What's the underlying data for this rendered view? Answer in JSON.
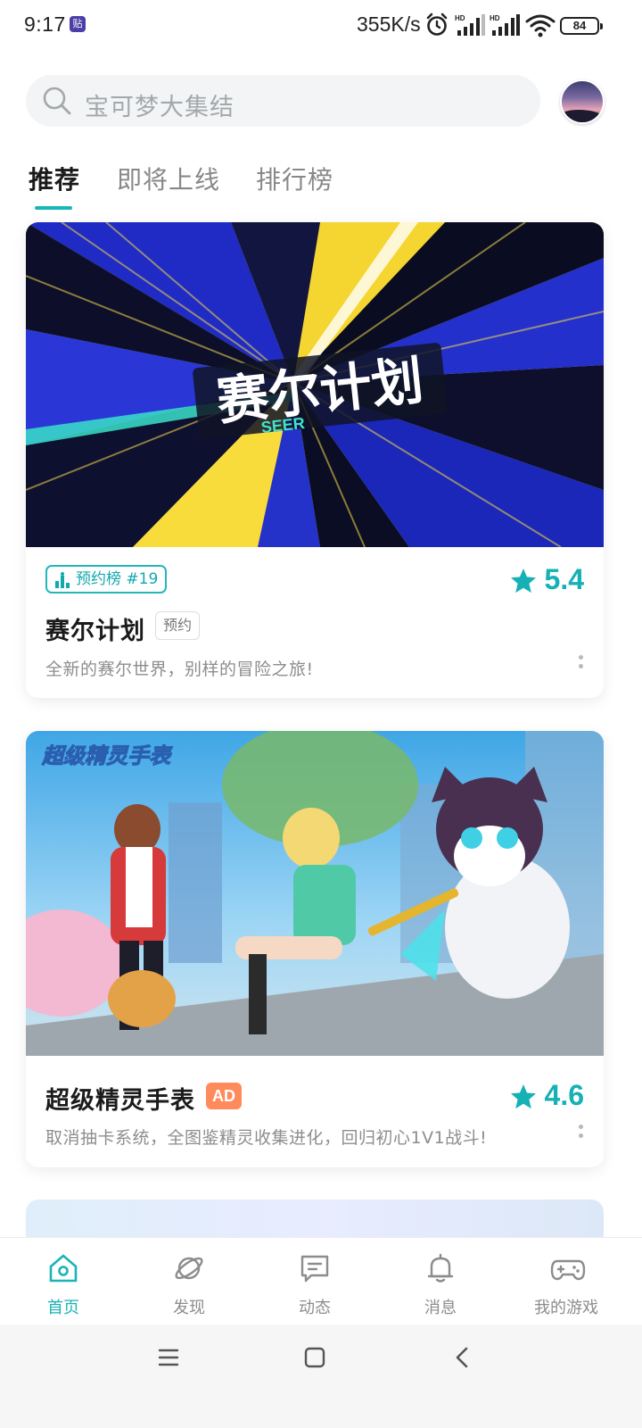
{
  "status_bar": {
    "time": "9:17",
    "notif_badge": "贴",
    "speed": "355K/s",
    "network": "HD",
    "battery": "84"
  },
  "search": {
    "placeholder": "宝可梦大集结"
  },
  "tabs": [
    {
      "label": "推荐",
      "active": true
    },
    {
      "label": "即将上线",
      "active": false
    },
    {
      "label": "排行榜",
      "active": false
    }
  ],
  "cards": [
    {
      "banner_logo_text": "赛尔计划",
      "banner_logo_sub": "SEER",
      "rank_badge": "预约榜 #19",
      "title": "赛尔计划",
      "tag": "预约",
      "rating": "5.4",
      "description": "全新的赛尔世界，别样的冒险之旅!"
    },
    {
      "banner_logo_text": "超级精灵手表",
      "title": "超级精灵手表",
      "tag": "AD",
      "rating": "4.6",
      "description": "取消抽卡系统，全图鉴精灵收集进化，回归初心1V1战斗!"
    }
  ],
  "bottom_nav": [
    {
      "label": "首页",
      "icon": "home-icon",
      "active": true
    },
    {
      "label": "发现",
      "icon": "planet-icon",
      "active": false
    },
    {
      "label": "动态",
      "icon": "chat-bubble-icon",
      "active": false
    },
    {
      "label": "消息",
      "icon": "bell-icon",
      "active": false
    },
    {
      "label": "我的游戏",
      "icon": "gamepad-icon",
      "active": false
    }
  ],
  "colors": {
    "accent": "#1bb3b7",
    "ad_tag": "#ff8a5b"
  }
}
